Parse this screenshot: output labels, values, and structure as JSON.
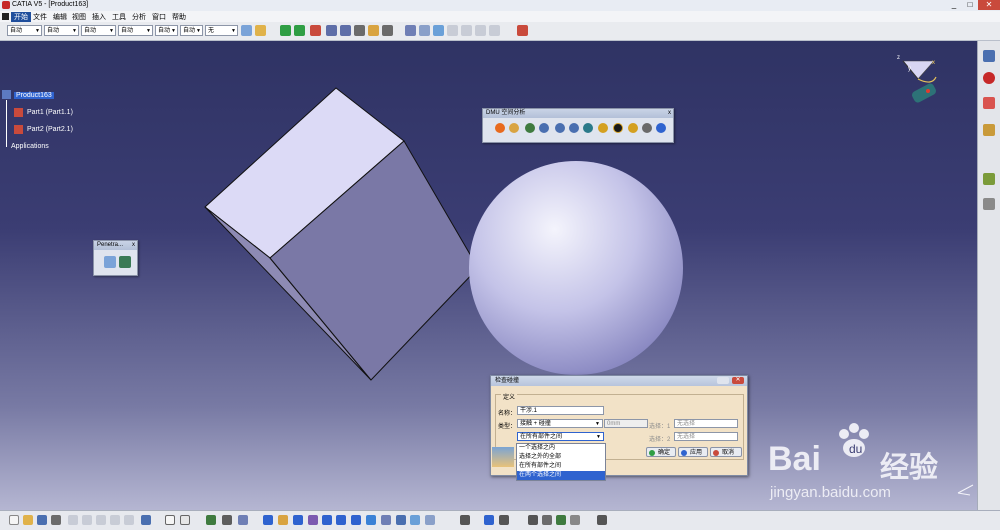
{
  "window": {
    "title": "CATIA V5 - [Product163]",
    "min": "_",
    "max": "□",
    "close": "✕"
  },
  "menu": [
    "开始",
    "文件",
    "编辑",
    "视图",
    "插入",
    "工具",
    "分析",
    "窗口",
    "帮助"
  ],
  "toolbar_combos": [
    "自动",
    "自动",
    "自动",
    "自动",
    "自动",
    "自动",
    "无"
  ],
  "tree": {
    "root": "Product163",
    "part1": "Part1 (Part1.1)",
    "part2": "Part2 (Part2.1)",
    "applications": "Applications"
  },
  "compass": {
    "x": "x",
    "y": "y",
    "z": "z"
  },
  "dmu_panel": {
    "title": "DMU 空间分析",
    "close": "x"
  },
  "penetration_panel": {
    "title": "Penetra...",
    "close": "x"
  },
  "dialog": {
    "title": "检查碰撞",
    "group": "定义",
    "name_label": "名称：",
    "name_value": "干涉.1",
    "type_label": "类型：",
    "type_value": "接触 + 碰撞",
    "clearance_value": "0mm",
    "sel1_label": "选择：1",
    "sel1_value": "无选择",
    "sel2_label": "选择：2",
    "sel2_value": "无选择",
    "scope_value": "在所有部件之间",
    "scope_options": [
      "一个选择之内",
      "选择之外的全部",
      "在所有部件之间",
      "在两个选择之间"
    ],
    "ok": "确定",
    "apply": "应用",
    "cancel": "取消"
  },
  "watermark": {
    "brand": "Bai",
    "brand2": "经验",
    "url": "jingyan.baidu.com"
  }
}
